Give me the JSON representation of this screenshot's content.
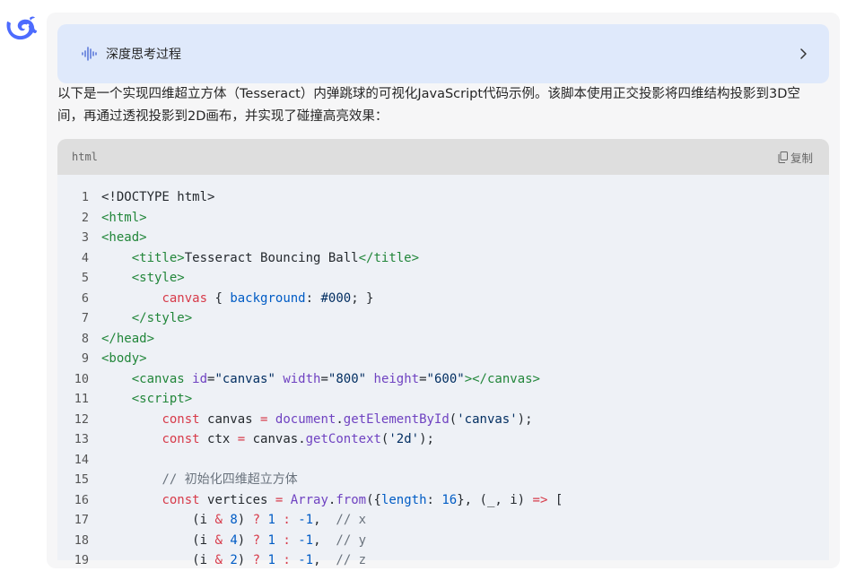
{
  "think_panel": {
    "label": "深度思考过程"
  },
  "intro_text": "以下是一个实现四维超立方体（Tesseract）内弹跳球的可视化JavaScript代码示例。该脚本使用正交投影将四维结构投影到3D空间，再通过透视投影到2D画布，并实现了碰撞高亮效果：",
  "code_block": {
    "language": "html",
    "copy_label": "复制",
    "lines": [
      {
        "n": "1",
        "segs": [
          [
            "plain",
            "<!DOCTYPE html>"
          ]
        ]
      },
      {
        "n": "2",
        "segs": [
          [
            "tag",
            "<html>"
          ]
        ]
      },
      {
        "n": "3",
        "segs": [
          [
            "tag",
            "<head>"
          ]
        ]
      },
      {
        "n": "4",
        "segs": [
          [
            "plain",
            "    "
          ],
          [
            "tag",
            "<title>"
          ],
          [
            "plain",
            "Tesseract Bouncing Ball"
          ],
          [
            "tag",
            "</title>"
          ]
        ]
      },
      {
        "n": "5",
        "segs": [
          [
            "plain",
            "    "
          ],
          [
            "tag",
            "<style>"
          ]
        ]
      },
      {
        "n": "6",
        "segs": [
          [
            "plain",
            "        "
          ],
          [
            "kw",
            "canvas"
          ],
          [
            "plain",
            " { "
          ],
          [
            "num",
            "background"
          ],
          [
            "plain",
            ": "
          ],
          [
            "str",
            "#000"
          ],
          [
            "plain",
            "; }"
          ]
        ]
      },
      {
        "n": "7",
        "segs": [
          [
            "plain",
            "    "
          ],
          [
            "tag",
            "</style>"
          ]
        ]
      },
      {
        "n": "8",
        "segs": [
          [
            "tag",
            "</head>"
          ]
        ]
      },
      {
        "n": "9",
        "segs": [
          [
            "tag",
            "<body>"
          ]
        ]
      },
      {
        "n": "10",
        "segs": [
          [
            "plain",
            "    "
          ],
          [
            "tag",
            "<canvas "
          ],
          [
            "attr",
            "id"
          ],
          [
            "plain",
            "="
          ],
          [
            "str",
            "\"canvas\""
          ],
          [
            "plain",
            " "
          ],
          [
            "attr",
            "width"
          ],
          [
            "plain",
            "="
          ],
          [
            "str",
            "\"800\""
          ],
          [
            "plain",
            " "
          ],
          [
            "attr",
            "height"
          ],
          [
            "plain",
            "="
          ],
          [
            "str",
            "\"600\""
          ],
          [
            "tag",
            "></canvas>"
          ]
        ]
      },
      {
        "n": "11",
        "segs": [
          [
            "plain",
            "    "
          ],
          [
            "tag",
            "<script>"
          ]
        ]
      },
      {
        "n": "12",
        "segs": [
          [
            "plain",
            "        "
          ],
          [
            "kw",
            "const"
          ],
          [
            "plain",
            " canvas "
          ],
          [
            "kw",
            "="
          ],
          [
            "plain",
            " "
          ],
          [
            "fn",
            "document"
          ],
          [
            "plain",
            "."
          ],
          [
            "fn",
            "getElementById"
          ],
          [
            "plain",
            "("
          ],
          [
            "str",
            "'canvas'"
          ],
          [
            "plain",
            ");"
          ]
        ]
      },
      {
        "n": "13",
        "segs": [
          [
            "plain",
            "        "
          ],
          [
            "kw",
            "const"
          ],
          [
            "plain",
            " ctx "
          ],
          [
            "kw",
            "="
          ],
          [
            "plain",
            " canvas."
          ],
          [
            "fn",
            "getContext"
          ],
          [
            "plain",
            "("
          ],
          [
            "str",
            "'2d'"
          ],
          [
            "plain",
            ");"
          ]
        ]
      },
      {
        "n": "14",
        "segs": [
          [
            "plain",
            ""
          ]
        ]
      },
      {
        "n": "15",
        "segs": [
          [
            "plain",
            "        "
          ],
          [
            "com",
            "// 初始化四维超立方体"
          ]
        ]
      },
      {
        "n": "16",
        "segs": [
          [
            "plain",
            "        "
          ],
          [
            "kw",
            "const"
          ],
          [
            "plain",
            " vertices "
          ],
          [
            "kw",
            "="
          ],
          [
            "plain",
            " "
          ],
          [
            "fn",
            "Array"
          ],
          [
            "plain",
            "."
          ],
          [
            "fn",
            "from"
          ],
          [
            "plain",
            "({"
          ],
          [
            "num",
            "length"
          ],
          [
            "plain",
            ": "
          ],
          [
            "num",
            "16"
          ],
          [
            "plain",
            "}, (_, i) "
          ],
          [
            "kw",
            "=>"
          ],
          [
            "plain",
            " ["
          ]
        ]
      },
      {
        "n": "17",
        "segs": [
          [
            "plain",
            "            (i "
          ],
          [
            "kw",
            "&"
          ],
          [
            "plain",
            " "
          ],
          [
            "num",
            "8"
          ],
          [
            "plain",
            ") "
          ],
          [
            "kw",
            "?"
          ],
          [
            "plain",
            " "
          ],
          [
            "num",
            "1"
          ],
          [
            "plain",
            " "
          ],
          [
            "kw",
            ":"
          ],
          [
            "plain",
            " "
          ],
          [
            "num",
            "-1"
          ],
          [
            "plain",
            ",  "
          ],
          [
            "com",
            "// x"
          ]
        ]
      },
      {
        "n": "18",
        "segs": [
          [
            "plain",
            "            (i "
          ],
          [
            "kw",
            "&"
          ],
          [
            "plain",
            " "
          ],
          [
            "num",
            "4"
          ],
          [
            "plain",
            ") "
          ],
          [
            "kw",
            "?"
          ],
          [
            "plain",
            " "
          ],
          [
            "num",
            "1"
          ],
          [
            "plain",
            " "
          ],
          [
            "kw",
            ":"
          ],
          [
            "plain",
            " "
          ],
          [
            "num",
            "-1"
          ],
          [
            "plain",
            ",  "
          ],
          [
            "com",
            "// y"
          ]
        ]
      },
      {
        "n": "19",
        "segs": [
          [
            "plain",
            "            (i "
          ],
          [
            "kw",
            "&"
          ],
          [
            "plain",
            " "
          ],
          [
            "num",
            "2"
          ],
          [
            "plain",
            ") "
          ],
          [
            "kw",
            "?"
          ],
          [
            "plain",
            " "
          ],
          [
            "num",
            "1"
          ],
          [
            "plain",
            " "
          ],
          [
            "kw",
            ":"
          ],
          [
            "plain",
            " "
          ],
          [
            "num",
            "-1"
          ],
          [
            "plain",
            ",  "
          ],
          [
            "com",
            "// z"
          ]
        ]
      }
    ]
  }
}
